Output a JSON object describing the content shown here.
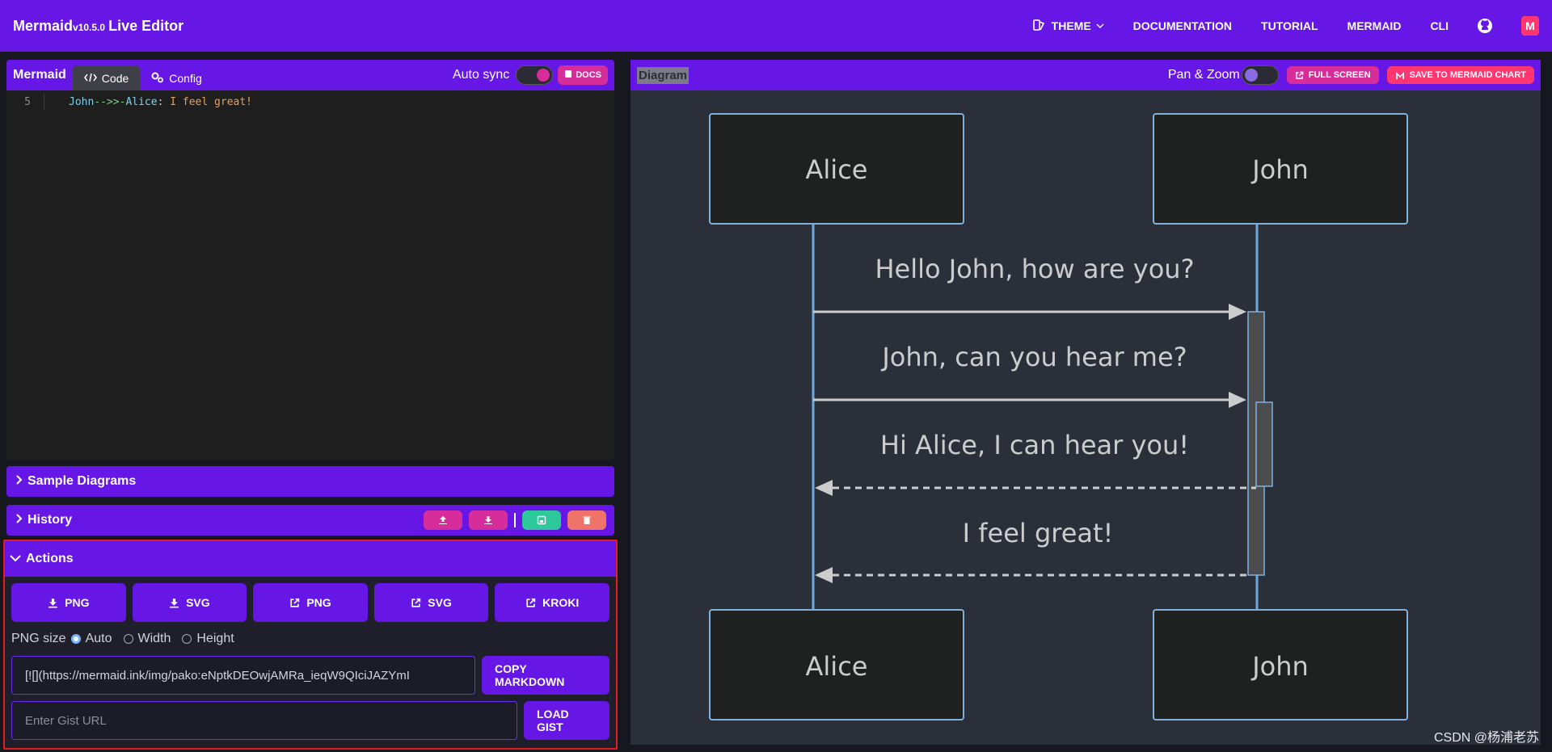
{
  "app": {
    "name": "Mermaid",
    "version": "v10.5.0",
    "subtitle": "Live Editor"
  },
  "nav": {
    "theme": "THEME",
    "documentation": "DOCUMENTATION",
    "tutorial": "TUTORIAL",
    "mermaid": "MERMAID",
    "cli": "CLI",
    "logo_letter": "M"
  },
  "editor": {
    "title": "Mermaid",
    "tab_code": "Code",
    "tab_config": "Config",
    "autosync_label": "Auto sync",
    "docs_label": "DOCS",
    "line_number": "5",
    "code_tokens": [
      "John",
      "-->>",
      "-",
      "Alice",
      ": ",
      "I feel great!"
    ]
  },
  "sections": {
    "samples": "Sample Diagrams",
    "history": "History",
    "actions": "Actions"
  },
  "actions": {
    "buttons": [
      "PNG",
      "SVG",
      "PNG",
      "SVG",
      "KROKI"
    ],
    "png_size_label": "PNG size",
    "opt_auto": "Auto",
    "opt_width": "Width",
    "opt_height": "Height",
    "markdown_value": "[![](https://mermaid.ink/img/pako:eNptkDEOwjAMRa_ieqW9QIciJAZYmI",
    "copy_markdown": "COPY MARKDOWN",
    "gist_placeholder": "Enter Gist URL",
    "load_gist": "LOAD GIST"
  },
  "diagram": {
    "label": "Diagram",
    "pan_zoom": "Pan & Zoom",
    "full_screen": "FULL SCREEN",
    "save_chart": "SAVE TO MERMAID CHART",
    "participants": [
      "Alice",
      "John"
    ],
    "messages": [
      "Hello John, how are you?",
      "John, can you hear me?",
      "Hi Alice, I can hear you!",
      "I feel great!"
    ]
  },
  "watermark": "CSDN @杨浦老苏",
  "colors": {
    "brand": "#6617e6",
    "pink": "#d62d9a",
    "green": "#2dc99a",
    "salmon": "#f0736a",
    "red_outline": "#e31e1e"
  }
}
